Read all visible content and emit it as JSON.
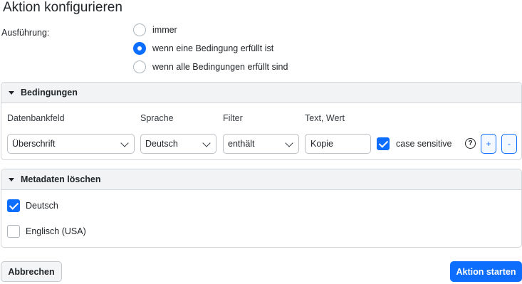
{
  "dialog": {
    "title": "Aktion konfigurieren"
  },
  "execution": {
    "label": "Ausführung:",
    "options": [
      {
        "label": "immer",
        "checked": false
      },
      {
        "label": "wenn eine Bedingung erfüllt ist",
        "checked": true
      },
      {
        "label": "wenn alle Bedingungen erfüllt sind",
        "checked": false
      }
    ]
  },
  "conditions": {
    "header": "Bedingungen",
    "columns": {
      "field": "Datenbankfeld",
      "language": "Sprache",
      "filter": "Filter",
      "value": "Text, Wert"
    },
    "row": {
      "field": "Überschrift",
      "language": "Deutsch",
      "filter": "enthält",
      "value": "Kopie",
      "case_sensitive_label": "case sensitive",
      "case_sensitive": true,
      "help_icon": "?",
      "add_label": "+",
      "remove_label": "-"
    }
  },
  "metadata": {
    "header": "Metadaten löschen",
    "items": [
      {
        "label": "Deutsch",
        "checked": true
      },
      {
        "label": "Englisch (USA)",
        "checked": false
      }
    ]
  },
  "footer": {
    "cancel_label": "Abbrechen",
    "start_label": "Aktion starten"
  },
  "icons": {
    "caret": "caret-down-icon",
    "chevron": "chevron-down-icon",
    "help": "question-circle-icon"
  },
  "colors": {
    "accent": "#0d6efd",
    "panel_header": "#f2f3f5",
    "border": "#d3d6da"
  }
}
